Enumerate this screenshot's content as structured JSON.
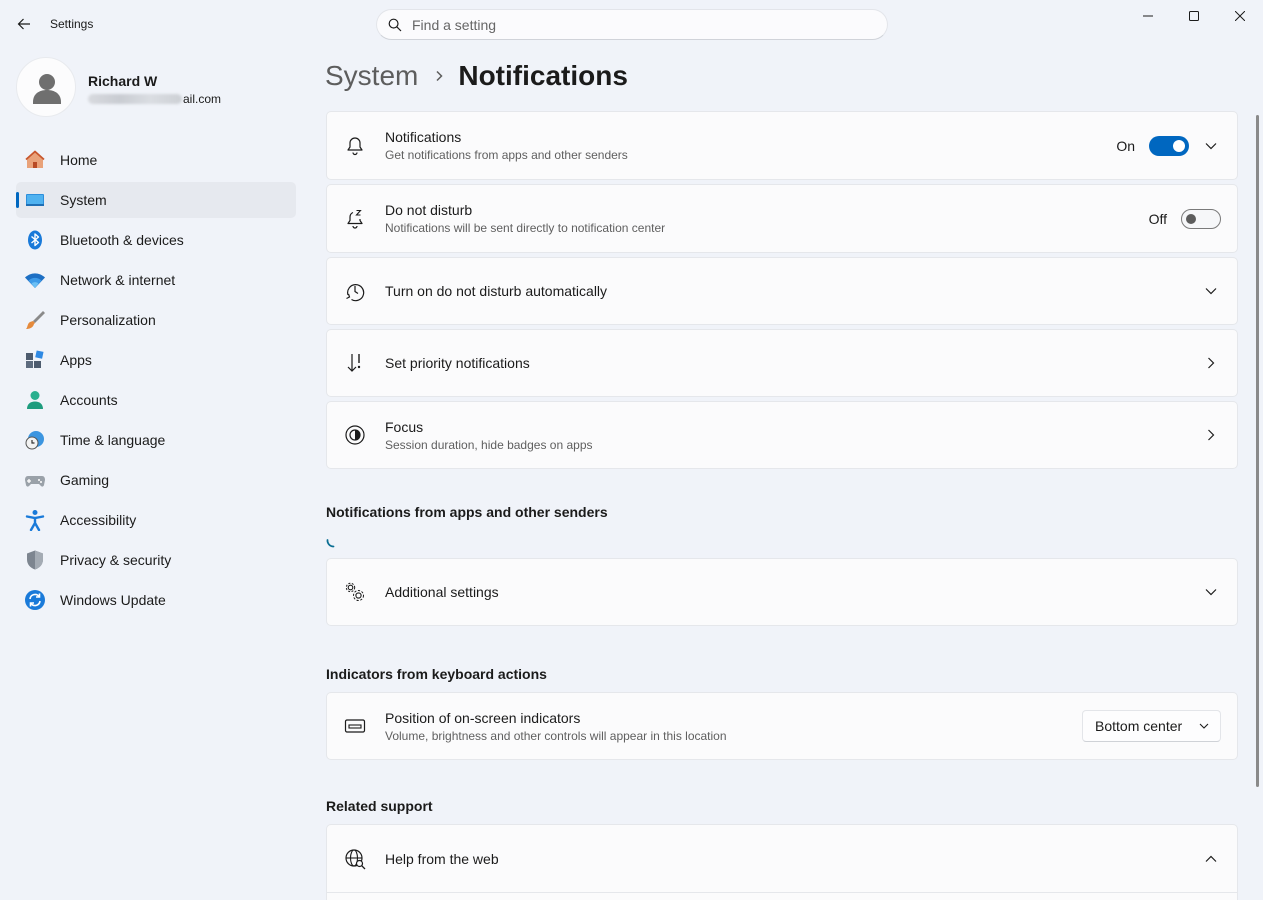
{
  "window": {
    "title": "Settings",
    "search_placeholder": "Find a setting"
  },
  "profile": {
    "name": "Richard W",
    "email_suffix": "ail.com"
  },
  "nav": [
    {
      "label": "Home",
      "icon": "home-icon",
      "selected": false
    },
    {
      "label": "System",
      "icon": "system-icon",
      "selected": true
    },
    {
      "label": "Bluetooth & devices",
      "icon": "bluetooth-icon",
      "selected": false
    },
    {
      "label": "Network & internet",
      "icon": "wifi-icon",
      "selected": false
    },
    {
      "label": "Personalization",
      "icon": "brush-icon",
      "selected": false
    },
    {
      "label": "Apps",
      "icon": "apps-icon",
      "selected": false
    },
    {
      "label": "Accounts",
      "icon": "accounts-icon",
      "selected": false
    },
    {
      "label": "Time & language",
      "icon": "clock-globe-icon",
      "selected": false
    },
    {
      "label": "Gaming",
      "icon": "gamepad-icon",
      "selected": false
    },
    {
      "label": "Accessibility",
      "icon": "accessibility-icon",
      "selected": false
    },
    {
      "label": "Privacy & security",
      "icon": "shield-icon",
      "selected": false
    },
    {
      "label": "Windows Update",
      "icon": "update-icon",
      "selected": false
    }
  ],
  "breadcrumb": {
    "parent": "System",
    "current": "Notifications"
  },
  "cards": {
    "notifications": {
      "title": "Notifications",
      "desc": "Get notifications from apps and other senders",
      "toggle_label": "On",
      "toggle_state": true
    },
    "dnd": {
      "title": "Do not disturb",
      "desc": "Notifications will be sent directly to notification center",
      "toggle_label": "Off",
      "toggle_state": false
    },
    "dnd_auto": {
      "title": "Turn on do not disturb automatically"
    },
    "priority": {
      "title": "Set priority notifications"
    },
    "focus": {
      "title": "Focus",
      "desc": "Session duration, hide badges on apps"
    }
  },
  "sections": {
    "apps_senders": "Notifications from apps and other senders",
    "indicators": "Indicators from keyboard actions",
    "related": "Related support"
  },
  "additional": {
    "title": "Additional settings"
  },
  "position": {
    "title": "Position of on-screen indicators",
    "desc": "Volume, brightness and other controls will appear in this location",
    "selected": "Bottom center"
  },
  "help": {
    "title": "Help from the web"
  },
  "colors": {
    "accent": "#0067c0",
    "background": "#f0f3f9",
    "card": "#fbfbfc"
  }
}
